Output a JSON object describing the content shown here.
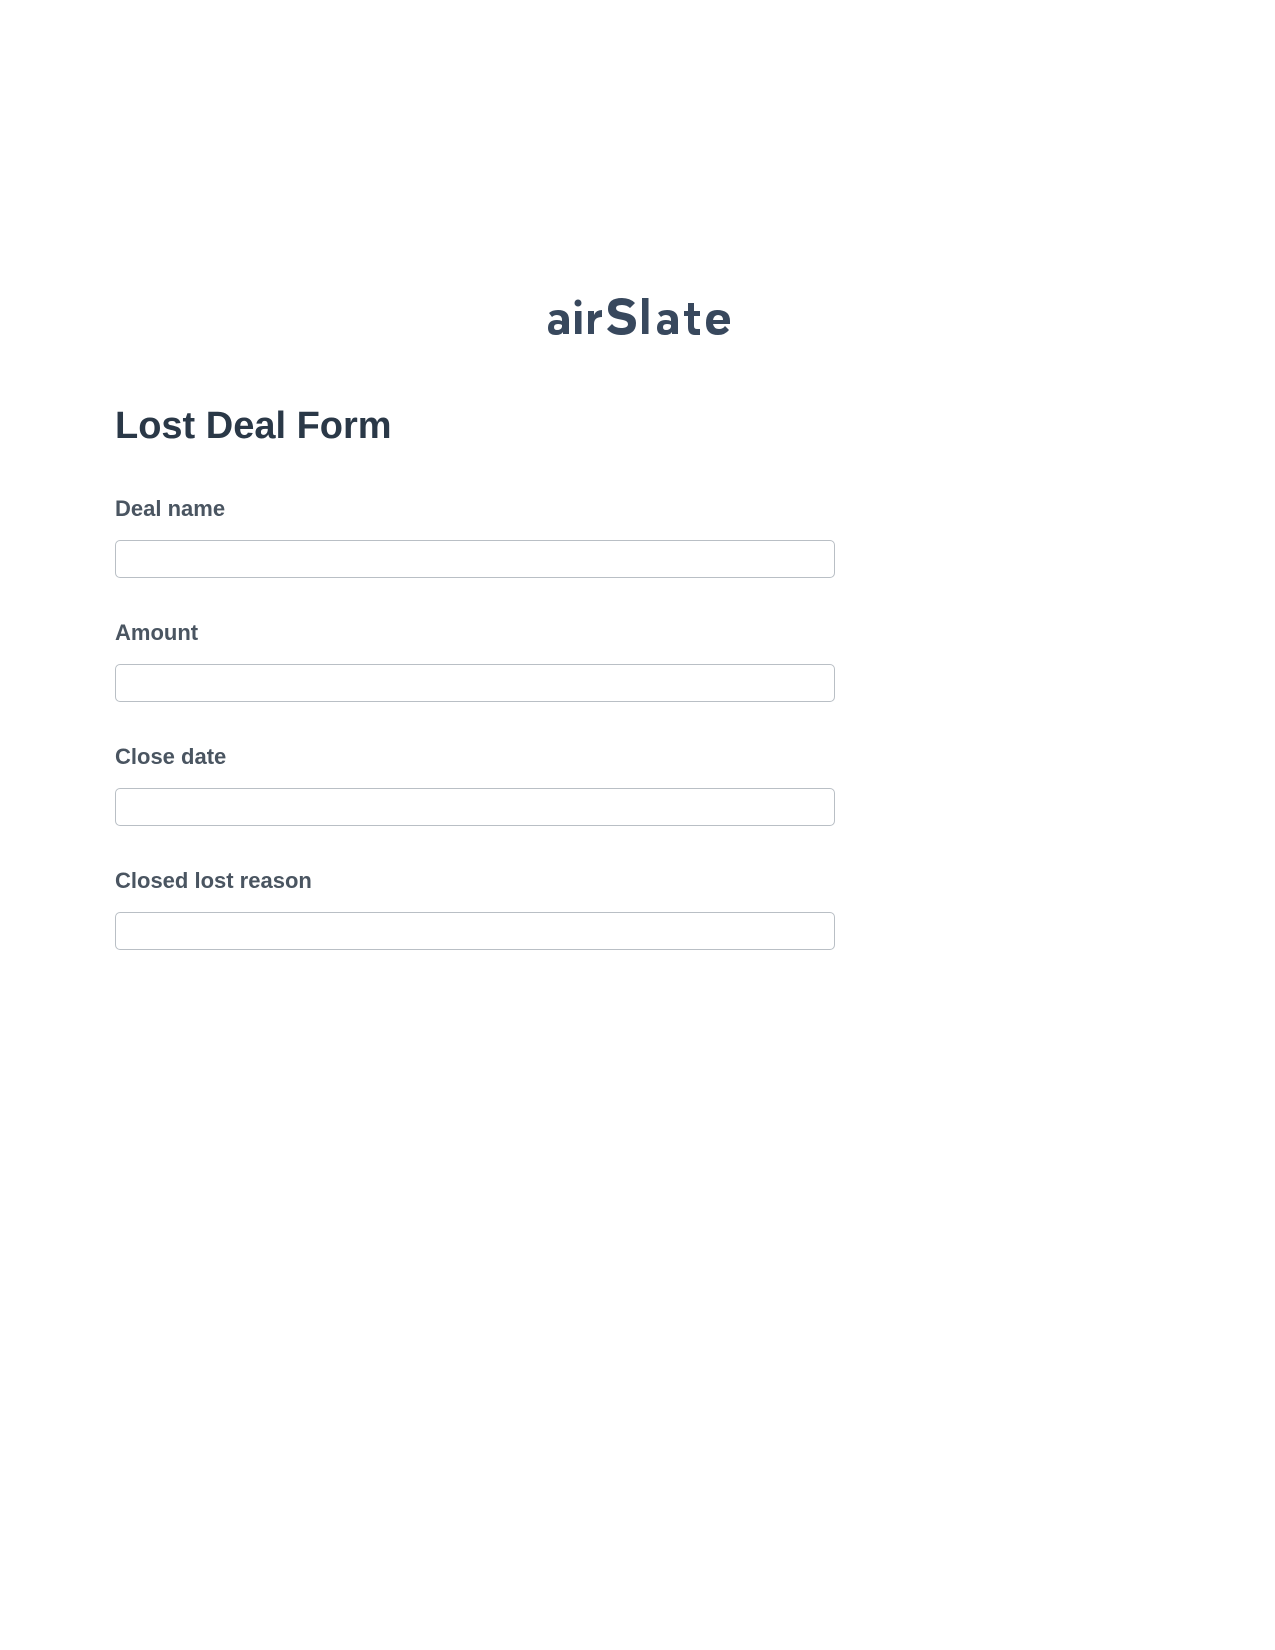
{
  "logo": {
    "brand_name": "airSlate",
    "color": "#38485d"
  },
  "form": {
    "title": "Lost Deal Form",
    "fields": [
      {
        "label": "Deal name",
        "value": ""
      },
      {
        "label": "Amount",
        "value": ""
      },
      {
        "label": "Close date",
        "value": ""
      },
      {
        "label": "Closed lost reason",
        "value": ""
      }
    ]
  }
}
